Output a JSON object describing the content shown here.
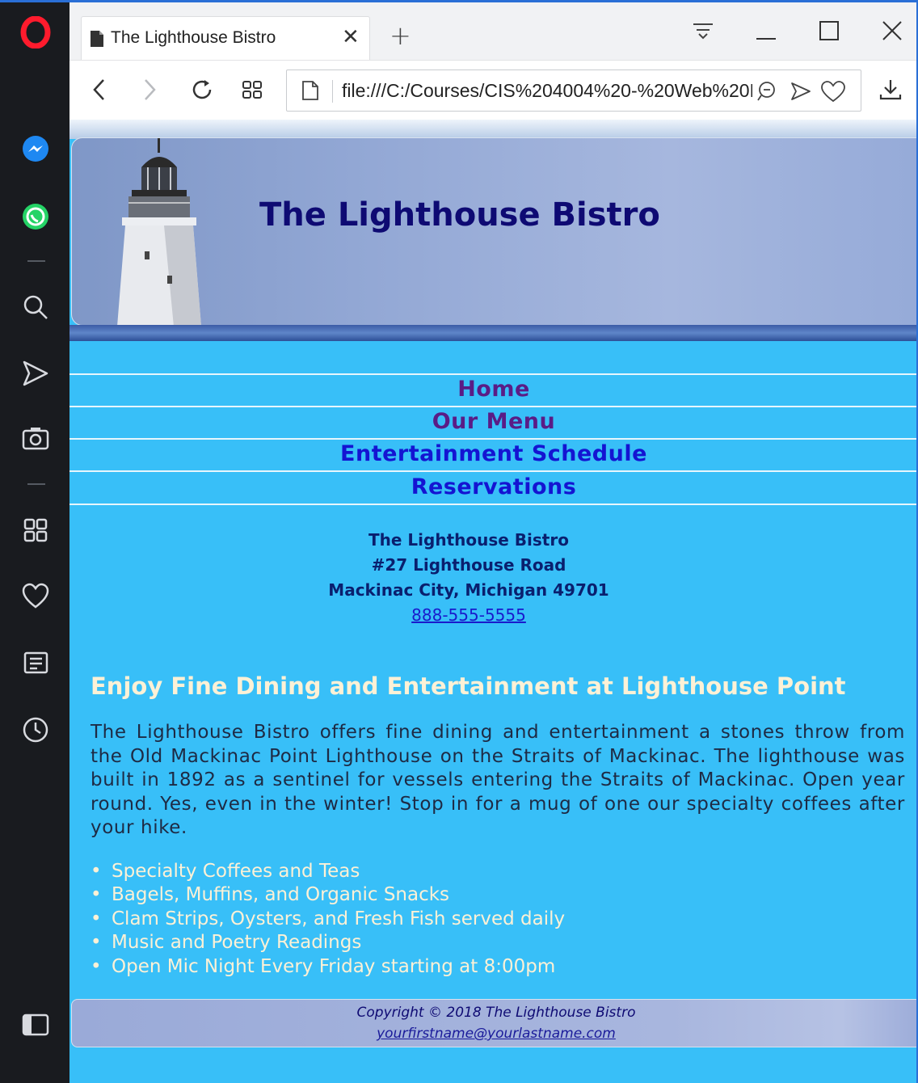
{
  "browser": {
    "tab_title": "The Lighthouse Bistro",
    "tab_close": "✕",
    "new_tab": "+",
    "address": "file:///C:/Courses/CIS%204004%20-%20Web%20Development/index.html",
    "sidebar_icons": [
      "opera-logo-icon",
      "messenger-icon",
      "whatsapp-icon",
      "search-icon",
      "send-icon",
      "camera-icon",
      "speed-dial-icon",
      "heart-icon",
      "news-icon",
      "history-icon",
      "sidebar-toggle-icon"
    ]
  },
  "site": {
    "title": "The Lighthouse Bistro",
    "nav": [
      {
        "label": "Home",
        "color": "#5a1c86"
      },
      {
        "label": "Our Menu",
        "color": "#5a1c86"
      },
      {
        "label": "Entertainment Schedule",
        "color": "#1414d2"
      },
      {
        "label": "Reservations",
        "color": "#1414d2"
      }
    ],
    "address": {
      "name": "The Lighthouse Bistro",
      "street": "#27 Lighthouse Road",
      "city": "Mackinac City, Michigan 49701",
      "phone": "888-555-5555"
    },
    "heading": "Enjoy Fine Dining and Entertainment at Lighthouse Point",
    "paragraph": "The Lighthouse Bistro offers fine dining and entertainment a stones throw from the Old Mackinac Point Lighthouse on the Straits of Mackinac. The lighthouse was built in 1892 as a sentinel for vessels entering the Straits of Mackinac. Open year round. Yes, even in the winter! Stop in for a mug of one our specialty coffees after your hike.",
    "features": [
      "Specialty Coffees and Teas",
      "Bagels, Muffins, and Organic Snacks",
      "Clam Strips, Oysters, and Fresh Fish served daily",
      "Music and Poetry Readings",
      "Open Mic Night Every Friday starting at 8:00pm"
    ],
    "footer": {
      "copyright": "Copyright © 2018 The Lighthouse Bistro",
      "email": "yourfirstname@yourlastname.com"
    }
  },
  "colors": {
    "page_bg": "#38bff8",
    "title": "#0e0a73",
    "heading": "#fdf1d6",
    "nav_visited": "#5a1c86",
    "nav_link": "#1414d2"
  }
}
